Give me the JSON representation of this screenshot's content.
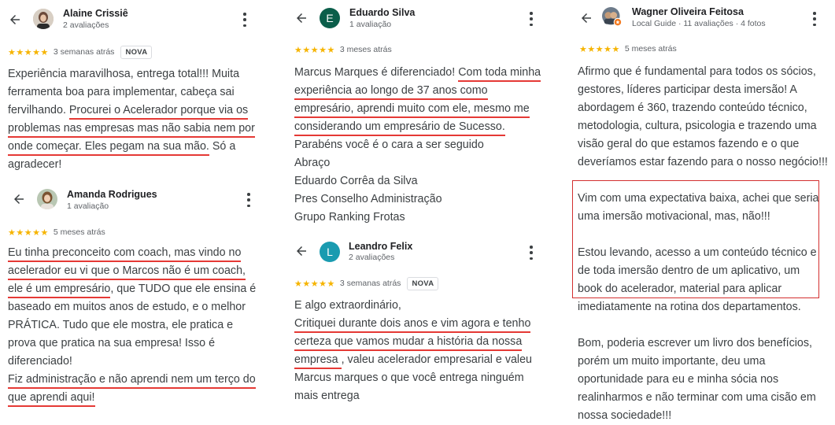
{
  "reviews": {
    "alaine": {
      "name": "Alaine Crissiê",
      "sub": "2 avaliações",
      "stars": "★★★★★",
      "when": "3 semanas atrás",
      "badge": "NOVA",
      "lines": [
        [
          "Experiência maravilhosa, entrega total!!! Muita"
        ],
        [
          "ferramenta boa para implementar, cabeça sai"
        ],
        [
          "fervilhando. ",
          "Procurei o Acelerador porque via os"
        ],
        [
          "problemas nas empresas mas não sabia nem por"
        ],
        [
          "onde começar. Eles pegam na sua mão.",
          " Só a"
        ],
        [
          "agradecer!"
        ]
      ]
    },
    "amanda": {
      "name": "Amanda Rodrigues",
      "sub": "1 avaliação",
      "stars": "★★★★★",
      "when": "5 meses atrás",
      "lines": [
        [
          "Eu tinha preconceito com coach, mas vindo no"
        ],
        [
          "acelerador eu vi que o Marcos não é um coach,"
        ],
        [
          "ele é um empresário",
          ", que TUDO que ele ensina é"
        ],
        [
          "baseado em muitos anos de estudo, e o melhor"
        ],
        [
          "PRÁTICA. Tudo que ele mostra, ele pratica e"
        ],
        [
          "prova que pratica na sua empresa! Isso é"
        ],
        [
          "diferenciado!"
        ],
        [
          "Fiz administração e não aprendi nem um terço do"
        ],
        [
          "que aprendi aqui!"
        ]
      ]
    },
    "eduardo": {
      "name": "Eduardo Silva",
      "initial": "E",
      "sub": "1 avaliação",
      "stars": "★★★★★",
      "when": "3 meses atrás",
      "lines": [
        [
          "Marcus Marques é diferenciado! ",
          "Com toda minha"
        ],
        [
          "experiência ao longo de 37 anos como"
        ],
        [
          "empresário, aprendi muito com ele, mesmo me"
        ],
        [
          "considerando um empresário de Sucesso."
        ],
        [
          "Parabéns você é o cara a ser seguido"
        ],
        [
          "Abraço"
        ],
        [
          "Eduardo Corrêa da Silva"
        ],
        [
          "Pres Conselho Administração"
        ],
        [
          "Grupo Ranking Frotas"
        ]
      ]
    },
    "leandro": {
      "name": "Leandro Felix",
      "initial": "L",
      "sub": "2 avaliações",
      "stars": "★★★★★",
      "when": "3 semanas atrás",
      "badge": "NOVA",
      "lines": [
        [
          "E algo extraordinário,"
        ],
        [
          "Critiquei durante dois anos e vim agora e tenho"
        ],
        [
          "certeza que vamos mudar a história da nossa"
        ],
        [
          "empresa ",
          ", valeu acelerador empresarial e valeu"
        ],
        [
          "Marcus marques o que você entrega ninguém"
        ],
        [
          "mais entrega"
        ]
      ]
    },
    "wagner": {
      "name": "Wagner Oliveira Feitosa",
      "sub": "Local Guide · 11 avaliações · 4 fotos",
      "stars": "★★★★★",
      "when": "5 meses atrás",
      "para1": [
        "Afirmo que é fundamental para todos os sócios,",
        "gestores, líderes participar desta imersão! A",
        "abordagem é 360, trazendo conteúdo técnico,",
        "metodologia, cultura, psicologia e trazendo uma",
        "visão geral do que estamos fazendo e o que",
        "deveríamos estar fazendo para o nosso negócio!!!"
      ],
      "para2": [
        "Vim com uma expectativa baixa, achei que seria",
        "uma imersão motivacional, mas, não!!!"
      ],
      "para3": [
        "Estou levando, acesso a um conteúdo técnico e",
        "de toda imersão dentro de um aplicativo, um",
        "book do acelerador, material para aplicar",
        "imediatamente na rotina dos departamentos."
      ],
      "para4": [
        "Bom, poderia escrever um livro dos benefícios,",
        "porém um muito importante, deu uma",
        "oportunidade para eu e minha sócia nos",
        "realinharmos e não terminar com uma cisão em",
        "nossa sociedade!!!"
      ]
    }
  },
  "colors": {
    "underline": "#e53935",
    "star": "#f6b400",
    "eduardo_avatar": "#0b5e4a",
    "leandro_avatar": "#1a9bb0",
    "box": "#d32f2f"
  }
}
